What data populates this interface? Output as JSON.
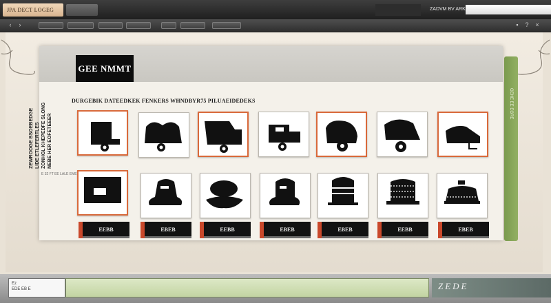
{
  "window": {
    "app_tab_label": "JPA DECT LOGEG",
    "mini_label": "ZADVM BV ARK",
    "mini_field_value": ""
  },
  "toolbar": {
    "icons": [
      "back-icon",
      "forward-icon",
      "settings-icon",
      "help-icon",
      "close-icon"
    ]
  },
  "header": {
    "logo_text": "GEE NMMT"
  },
  "content": {
    "heading": "DURGEBIK DATEEDKEK FENKERS WHNDBYR75 PILUAEIDEDEKS",
    "vertical_texts": [
      "ZEWROOGE BSOEBEDGE",
      "LIDE ETLEFERTLES",
      "ZONHGL KHEPEDFE SLONG",
      "NEBE HER EOFETEEER"
    ],
    "vertical_caption": "E 32 FT EE LALE EME",
    "rail_text": "GEHE EE EGRE"
  },
  "products": {
    "row1_icons": [
      "helmet-icon",
      "helmet-icon",
      "helmet-icon",
      "helmet-icon",
      "helmet-icon",
      "helmet-icon",
      "helmet-icon"
    ],
    "row2_icons": [
      "cap-icon",
      "hat-icon",
      "hat-icon",
      "hat-icon",
      "hat-icon",
      "hat-icon",
      "hat-icon"
    ],
    "labels": [
      "EEBB",
      "EBEB",
      "EEBB",
      "EBEB",
      "EBEB",
      "EEBB",
      "EBEB"
    ]
  },
  "statusbar": {
    "field_text": "Ez",
    "field_text_2": "EDE EB E",
    "end_text": "ZEDE"
  },
  "colors": {
    "accent_orange": "#d9693a",
    "rail_green": "#8aa85a",
    "label_red": "#c9482b"
  }
}
